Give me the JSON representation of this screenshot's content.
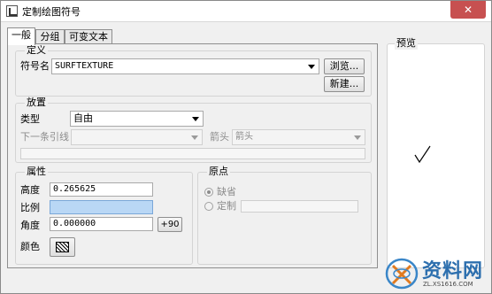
{
  "window": {
    "title": "定制绘图符号",
    "close_glyph": "✕"
  },
  "tabs": [
    {
      "label": "一般"
    },
    {
      "label": "分组"
    },
    {
      "label": "可变文本"
    }
  ],
  "definition": {
    "legend": "定义",
    "symbol_name_label": "符号名",
    "symbol_name_value": "SURFTEXTURE",
    "browse_button": "浏览...",
    "new_button": "新建..."
  },
  "placement": {
    "legend": "放置",
    "type_label": "类型",
    "type_value": "自由",
    "next_leader_label": "下一条引线",
    "next_leader_value": "",
    "arrow_label": "箭头",
    "arrow_value": "箭头"
  },
  "attributes": {
    "legend": "属性",
    "height_label": "高度",
    "height_value": "0.265625",
    "scale_label": "比例",
    "scale_value": "",
    "angle_label": "角度",
    "angle_value": "0.000000",
    "rotate_button": "+90",
    "color_label": "颜色"
  },
  "origin": {
    "legend": "原点",
    "default_label": "缺省",
    "custom_label": "定制",
    "selected": "default",
    "custom_value": ""
  },
  "preview": {
    "legend": "预览"
  },
  "watermark": {
    "brand": "资料网",
    "url": "ZL.XS1616.COM"
  }
}
